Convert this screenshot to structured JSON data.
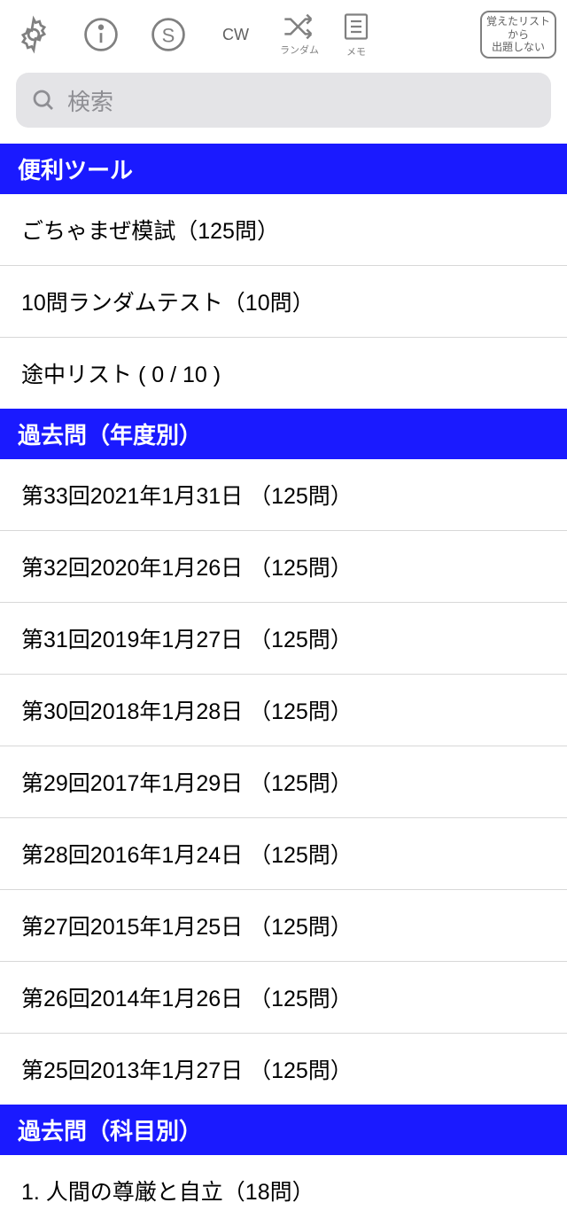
{
  "toolbar": {
    "cw": "CW",
    "random_label": "ランダム",
    "memo_label": "メモ",
    "badge_line1": "覚えたリスト",
    "badge_line2": "から",
    "badge_line3": "出題しない"
  },
  "search": {
    "placeholder": "検索"
  },
  "sections": [
    {
      "header": "便利ツール",
      "items": [
        "ごちゃまぜ模試（125問）",
        "10問ランダムテスト（10問）",
        "途中リスト ( 0 / 10 )"
      ]
    },
    {
      "header": "過去問（年度別）",
      "items": [
        "第33回2021年1月31日 （125問）",
        "第32回2020年1月26日 （125問）",
        "第31回2019年1月27日 （125問）",
        "第30回2018年1月28日 （125問）",
        "第29回2017年1月29日 （125問）",
        "第28回2016年1月24日 （125問）",
        "第27回2015年1月25日 （125問）",
        "第26回2014年1月26日 （125問）",
        "第25回2013年1月27日 （125問）"
      ]
    },
    {
      "header": "過去問（科目別）",
      "items": [
        "1. 人間の尊厳と自立（18問）"
      ]
    }
  ]
}
